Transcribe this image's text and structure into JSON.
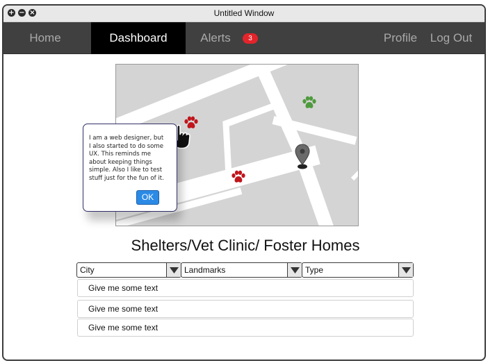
{
  "window": {
    "title": "Untitled Window"
  },
  "nav": {
    "items": [
      {
        "label": "Home",
        "active": false
      },
      {
        "label": "Dashboard",
        "active": true
      },
      {
        "label": "Alerts",
        "active": false,
        "badge": "3"
      },
      {
        "label": "Profile",
        "active": false
      },
      {
        "label": "Log Out",
        "active": false
      }
    ]
  },
  "map": {
    "markers": [
      {
        "icon": "paw-icon",
        "color": "#c0151c"
      },
      {
        "icon": "paw-icon",
        "color": "#c0151c"
      },
      {
        "icon": "paw-icon",
        "color": "#4f9a3e"
      },
      {
        "icon": "map-pin-icon",
        "color": "#555555"
      }
    ],
    "cursor_icon": "hand-pointer-icon"
  },
  "popup": {
    "text": "I am a web designer, but I also started to do some UX. This reminds me about keeping things simple. Also I like to test stuff just for the fun of it.",
    "ok_label": "OK"
  },
  "section": {
    "title": "Shelters/Vet Clinic/ Foster Homes"
  },
  "filters": [
    {
      "value": "City"
    },
    {
      "value": "Landmarks"
    },
    {
      "value": "Type"
    }
  ],
  "results": [
    {
      "text": "Give me some text"
    },
    {
      "text": "Give me some text"
    },
    {
      "text": "Give me some text"
    }
  ],
  "colors": {
    "navbar": "#404040",
    "nav_active": "#000000",
    "badge": "#e3242b",
    "ok_button": "#2b8ae6",
    "paw_red": "#c0151c",
    "paw_green": "#4f9a3e"
  }
}
